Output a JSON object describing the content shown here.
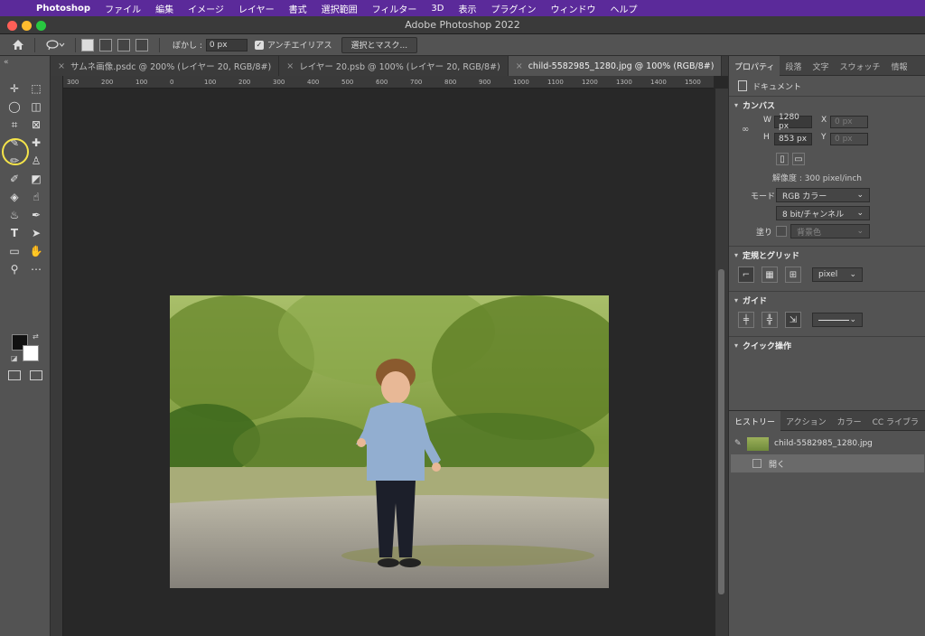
{
  "menubar": {
    "app": "Photoshop",
    "items": [
      "ファイル",
      "編集",
      "イメージ",
      "レイヤー",
      "書式",
      "選択範囲",
      "フィルター",
      "3D",
      "表示",
      "プラグイン",
      "ウィンドウ",
      "ヘルプ"
    ]
  },
  "window": {
    "title": "Adobe Photoshop 2022"
  },
  "options": {
    "feather_label": "ぼかし :",
    "feather_value": "0 px",
    "antialias_label": "アンチエイリアス",
    "select_mask_label": "選択とマスク..."
  },
  "tabs": [
    {
      "label": "サムネ画像.psdc @ 200% (レイヤー 20, RGB/8#)",
      "active": false
    },
    {
      "label": "レイヤー 20.psb @ 100% (レイヤー 20, RGB/8#)",
      "active": false
    },
    {
      "label": "child-5582985_1280.jpg @ 100% (RGB/8#)",
      "active": true
    }
  ],
  "rulers": {
    "top": [
      "300",
      "200",
      "100",
      "0",
      "100",
      "200",
      "300",
      "400",
      "500",
      "600",
      "700",
      "800",
      "900",
      "1000",
      "1100",
      "1200",
      "1300",
      "1400",
      "1500"
    ]
  },
  "properties": {
    "tabs": [
      "プロパティ",
      "段落",
      "文字",
      "スウォッチ",
      "情報"
    ],
    "doc_label": "ドキュメント",
    "canvas": {
      "heading": "カンバス",
      "w_label": "W",
      "w_value": "1280 px",
      "h_label": "H",
      "h_value": "853 px",
      "x_label": "X",
      "x_value": "0 px",
      "y_label": "Y",
      "y_value": "0 px",
      "resolution": "解像度 : 300 pixel/inch",
      "mode_label": "モード",
      "mode_value": "RGB カラー",
      "depth_value": "8 bit/チャンネル",
      "fill_label": "塗り",
      "fill_value": "背景色"
    },
    "rulers_grid": {
      "heading": "定規とグリッド",
      "unit": "pixel"
    },
    "guides": {
      "heading": "ガイド"
    },
    "quick": {
      "heading": "クイック操作"
    }
  },
  "history": {
    "tabs": [
      "ヒストリー",
      "アクション",
      "カラー",
      "CC ライブラ"
    ],
    "snapshot": "child-5582985_1280.jpg",
    "step": "開く"
  },
  "colors": {
    "menubar": "#5b2a9a",
    "highlight": "#f5e44a",
    "foreground": "#111111",
    "background": "#ffffff"
  }
}
